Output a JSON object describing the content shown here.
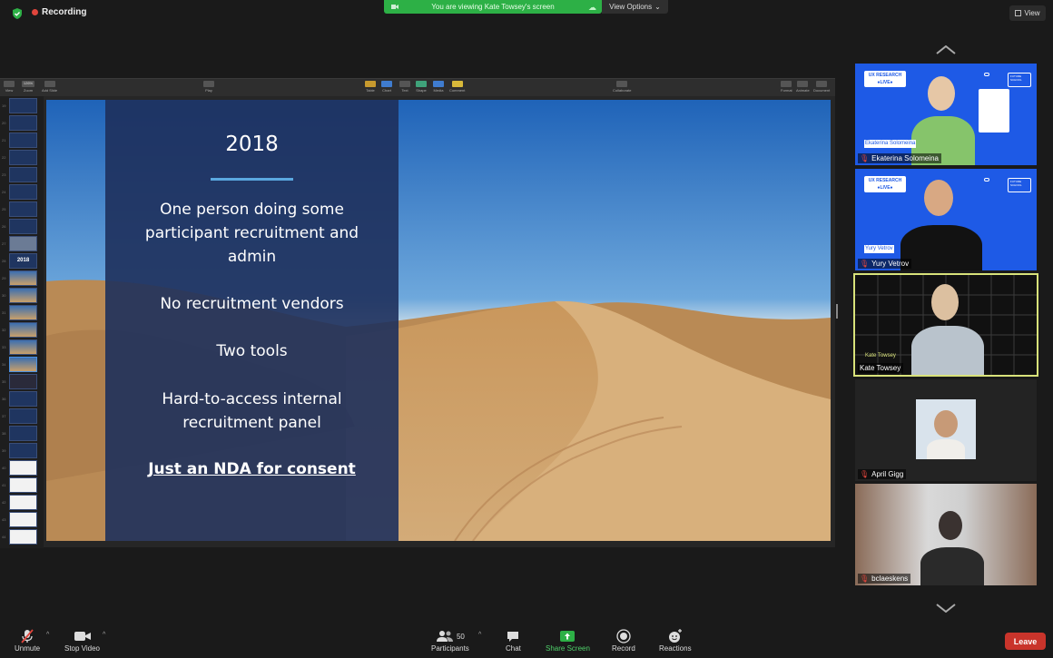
{
  "topbar": {
    "recording_label": "Recording",
    "banner_text": "You are viewing Kate Towsey's screen",
    "view_options_label": "View Options",
    "view_label": "View"
  },
  "keynote": {
    "toolbar": {
      "view": "View",
      "zoom_value": "126%",
      "zoom": "Zoom",
      "add_slide": "Add Slide",
      "play": "Play",
      "table": "Table",
      "chart": "Chart",
      "text": "Text",
      "shape": "Shape",
      "media": "Media",
      "comment": "Comment",
      "collaborate": "Collaborate",
      "format": "Format",
      "animate": "Animate",
      "document": "Document"
    },
    "thumbnail_numbers": [
      "19",
      "20",
      "21",
      "22",
      "23",
      "24",
      "25",
      "26",
      "27",
      "28",
      "29",
      "30",
      "31",
      "32",
      "33",
      "34",
      "35",
      "36",
      "37",
      "38",
      "39",
      "40",
      "41",
      "42",
      "43",
      "44"
    ],
    "thumb_2018_label": "2018"
  },
  "slide": {
    "title": "2018",
    "items": [
      "One person doing some participant recruitment and admin",
      "No recruitment vendors",
      "Two tools",
      "Hard-to-access internal recruitment panel"
    ],
    "link_text": "Just an NDA for consent"
  },
  "participants": [
    {
      "name": "Ekaterina Solomeina",
      "muted": true,
      "overlay": "Ekaterina Solomeina"
    },
    {
      "name": "Yury Vetrov",
      "muted": true,
      "overlay": "Yury Vetrov"
    },
    {
      "name": "Kate Towsey",
      "muted": false,
      "overlay": "Kate Towsey"
    },
    {
      "name": "April Gigg",
      "muted": true
    },
    {
      "name": "bclaeskens",
      "muted": true
    }
  ],
  "bg_text": {
    "ux_research": "UX RESEARCH",
    "live": "●LIVE●",
    "future": "FUTURE SCHOOL"
  },
  "bottombar": {
    "unmute": "Unmute",
    "stop_video": "Stop Video",
    "participants": "Participants",
    "participants_count": "50",
    "chat": "Chat",
    "share_screen": "Share Screen",
    "record": "Record",
    "reactions": "Reactions",
    "leave": "Leave"
  },
  "colors": {
    "recording_red": "#e0453c",
    "share_green": "#2db046",
    "leave_red": "#c9342b",
    "active_speaker": "#d8e27a",
    "ux_blue": "#1e5ae6"
  }
}
